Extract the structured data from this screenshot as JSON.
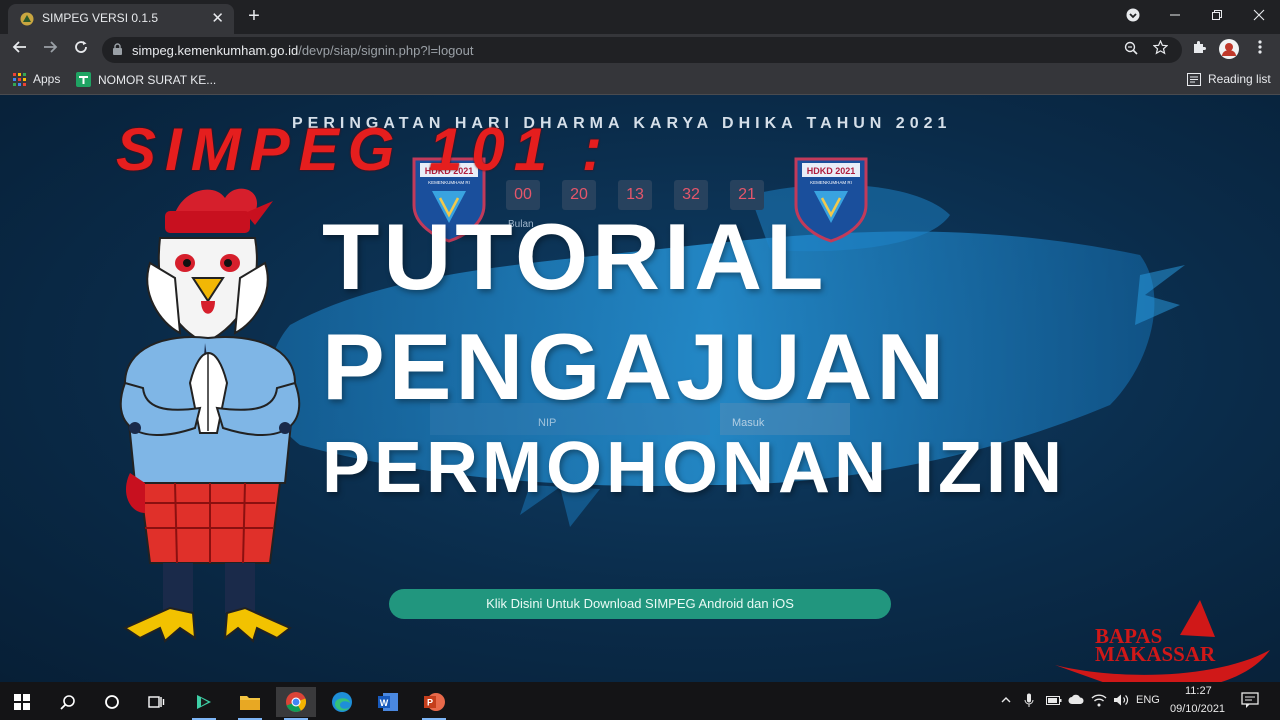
{
  "browser": {
    "tab_title": "SIMPEG VERSI 0.1.5",
    "tab_close": "✕",
    "new_tab": "+",
    "url_host": "simpeg.kemenkumham.go.id",
    "url_path": "/devp/siap/signin.php?l=logout",
    "bookmarks": {
      "apps": "Apps",
      "nomor_surat": "NOMOR SURAT KE...",
      "reading_list": "Reading list"
    }
  },
  "page": {
    "event_title": "PERINGATAN HARI DHARMA KARYA DHIKA TAHUN 2021",
    "overlay_title": "SIMPEG 101 :",
    "countdown": [
      "00",
      "20",
      "13",
      "32",
      "21"
    ],
    "countdown_caption": "Bulan",
    "badge_text": "HDKD 2021",
    "badge_subtext": "KEMENKUMHAM RI",
    "headline": {
      "line1": "TUTORIAL",
      "line2": "PENGAJUAN",
      "line3": "PERMOHONAN IZIN"
    },
    "ghost_fields": {
      "nip": "NIP",
      "masuk": "Masuk"
    },
    "download_button": "Klik Disini Untuk Download SIMPEG Android dan iOS",
    "logo_bapas": "BAPAS",
    "logo_makassar": "MAKASSAR"
  },
  "taskbar": {
    "lang": "ENG",
    "time": "11:27",
    "date": "09/10/2021"
  },
  "colors": {
    "page_bg": "#0a2b49",
    "accent_red": "#e51e1e",
    "download_button": "#21967e",
    "countdown_text": "#e5566b"
  }
}
